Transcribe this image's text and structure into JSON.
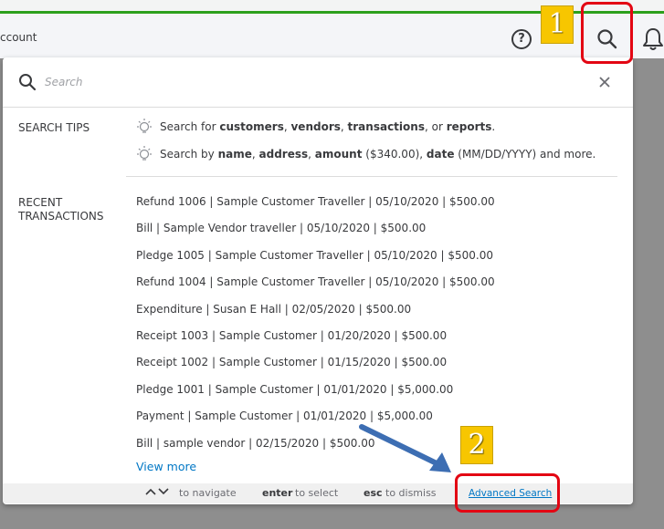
{
  "header": {
    "title": "ccount",
    "help_label": "?"
  },
  "colors": {
    "brand_green": "#2ca01c",
    "link_blue": "#0077c5",
    "callout_red": "#e30613",
    "badge_yellow": "#f7c600"
  },
  "icons": [
    "help-icon",
    "search-icon",
    "bell-icon",
    "close-icon",
    "lightbulb-icon",
    "chevron-up-icon",
    "chevron-down-icon"
  ],
  "callouts": [
    {
      "number": "1",
      "target": "search-button"
    },
    {
      "number": "2",
      "target": "advanced-search-link"
    }
  ],
  "search": {
    "placeholder": "Search"
  },
  "tips": {
    "label": "SEARCH TIPS",
    "items": [
      {
        "segments": [
          {
            "text": "Search for ",
            "bold": false
          },
          {
            "text": "customers",
            "bold": true
          },
          {
            "text": ", ",
            "bold": false
          },
          {
            "text": "vendors",
            "bold": true
          },
          {
            "text": ", ",
            "bold": false
          },
          {
            "text": "transactions",
            "bold": true
          },
          {
            "text": ", or ",
            "bold": false
          },
          {
            "text": "reports",
            "bold": true
          },
          {
            "text": ".",
            "bold": false
          }
        ]
      },
      {
        "segments": [
          {
            "text": "Search by ",
            "bold": false
          },
          {
            "text": "name",
            "bold": true
          },
          {
            "text": ", ",
            "bold": false
          },
          {
            "text": "address",
            "bold": true
          },
          {
            "text": ", ",
            "bold": false
          },
          {
            "text": "amount",
            "bold": true
          },
          {
            "text": " ($340.00), ",
            "bold": false
          },
          {
            "text": "date",
            "bold": true
          },
          {
            "text": " (MM/DD/YYYY) and more.",
            "bold": false
          }
        ]
      }
    ]
  },
  "recent": {
    "label_line1": "RECENT",
    "label_line2": "TRANSACTIONS",
    "items": [
      "Refund 1006 | Sample Customer Traveller | 05/10/2020 | $500.00",
      "Bill  | Sample Vendor traveller | 05/10/2020 | $500.00",
      "Pledge 1005 | Sample Customer Traveller | 05/10/2020 | $500.00",
      "Refund 1004 | Sample Customer Traveller | 05/10/2020 | $500.00",
      "Expenditure  | Susan E Hall | 02/05/2020 | $500.00",
      "Receipt 1003 | Sample Customer | 01/20/2020 | $500.00",
      "Receipt 1002 | Sample Customer | 01/15/2020 | $500.00",
      "Pledge 1001 | Sample Customer | 01/01/2020 | $5,000.00",
      "Payment  | Sample Customer | 01/01/2020 | $5,000.00",
      "Bill  | sample vendor | 02/15/2020 | $500.00"
    ],
    "view_more": "View more"
  },
  "footer": {
    "navigate_text": "to navigate",
    "enter_key": "enter",
    "enter_text": "to select",
    "esc_key": "esc",
    "esc_text": "to dismiss",
    "advanced_search": "Advanced Search"
  }
}
